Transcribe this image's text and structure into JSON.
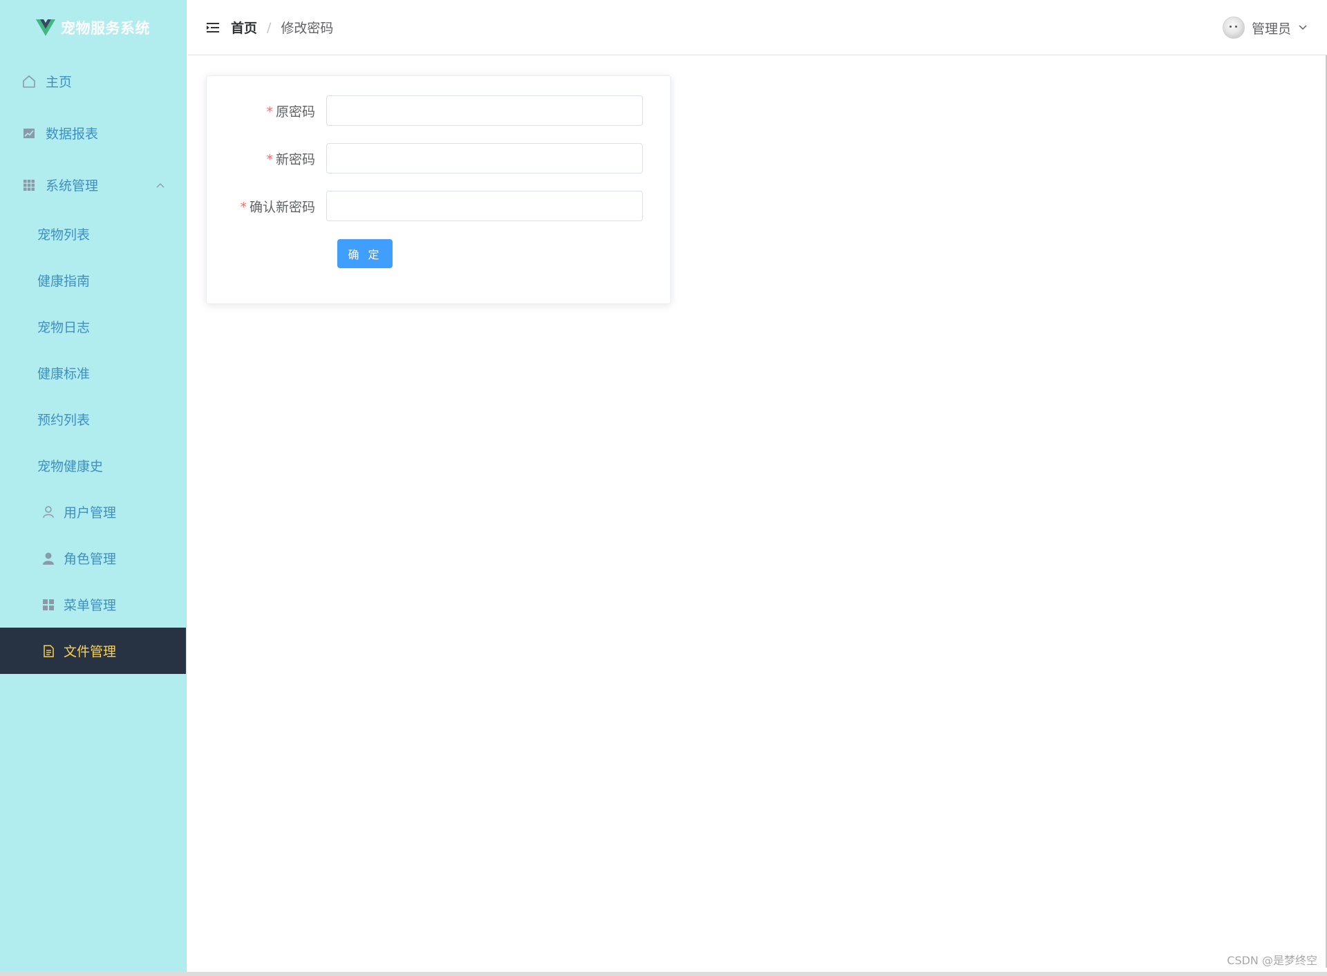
{
  "app": {
    "title": "宠物服务系统"
  },
  "sidebar": {
    "items": [
      {
        "label": "主页",
        "icon": "home-icon"
      },
      {
        "label": "数据报表",
        "icon": "chart-icon"
      },
      {
        "label": "系统管理",
        "icon": "grid-icon",
        "expanded": true
      }
    ],
    "submenu": [
      {
        "label": "宠物列表"
      },
      {
        "label": "健康指南"
      },
      {
        "label": "宠物日志"
      },
      {
        "label": "健康标准"
      },
      {
        "label": "预约列表"
      },
      {
        "label": "宠物健康史"
      },
      {
        "label": "用户管理",
        "icon": "user-icon"
      },
      {
        "label": "角色管理",
        "icon": "user-filled-icon"
      },
      {
        "label": "菜单管理",
        "icon": "menu-icon"
      },
      {
        "label": "文件管理",
        "icon": "document-icon",
        "active": true
      }
    ]
  },
  "header": {
    "breadcrumb": {
      "home": "首页",
      "separator": "/",
      "current": "修改密码"
    },
    "user": {
      "name": "管理员"
    }
  },
  "form": {
    "fields": [
      {
        "label": "原密码",
        "value": "",
        "required": true
      },
      {
        "label": "新密码",
        "value": "",
        "required": true
      },
      {
        "label": "确认新密码",
        "value": "",
        "required": true
      }
    ],
    "submit_label": "确 定"
  },
  "watermark": "CSDN @是梦终空",
  "colors": {
    "sidebar_bg": "#b1ecee",
    "sidebar_text": "#3f8fc0",
    "active_bg": "#273343",
    "active_text": "#ffd04b",
    "primary": "#409eff",
    "required_star": "#f56c6c"
  }
}
